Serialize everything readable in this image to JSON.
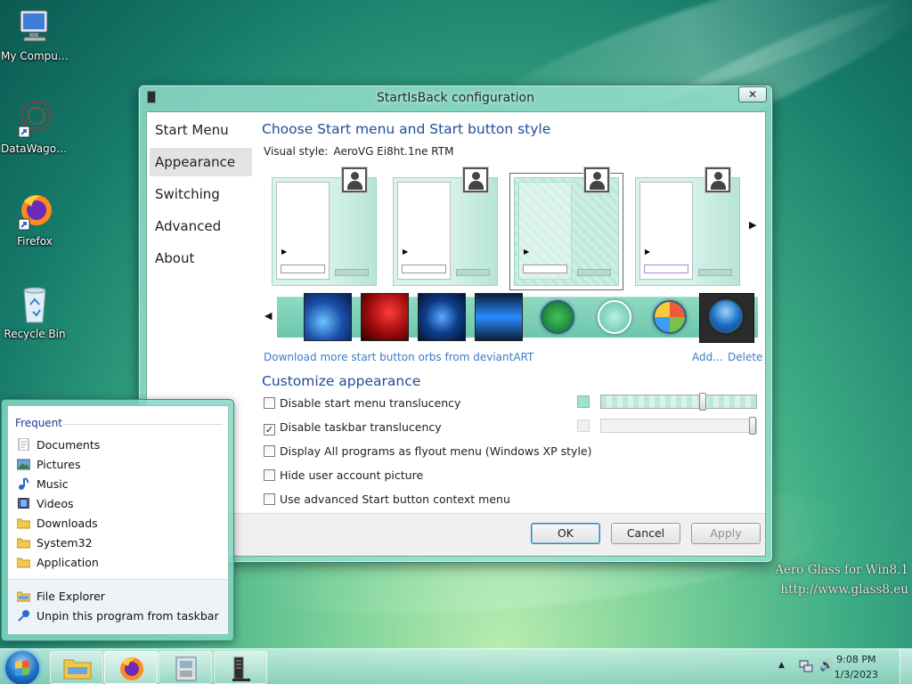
{
  "desktop": {
    "icons": [
      {
        "label": "My Computer",
        "icon": "computer-icon"
      },
      {
        "label": "DataWagon...",
        "icon": "datawagon-icon"
      },
      {
        "label": "Firefox",
        "icon": "firefox-icon"
      },
      {
        "label": "Recycle Bin",
        "icon": "recycle-bin-icon"
      }
    ],
    "watermark": {
      "line1": "Aero Glass for Win8.1",
      "line2": "http://www.glass8.eu"
    }
  },
  "window": {
    "title": "StartIsBack configuration",
    "close_glyph": "✕",
    "nav": [
      "Start Menu",
      "Appearance",
      "Switching",
      "Advanced",
      "About"
    ],
    "active_nav": "Appearance",
    "style_heading": "Choose Start menu and Start button style",
    "visual_style_label": "Visual style:",
    "visual_style_value": "AeroVG Ei8ht.1ne RTM",
    "download_link": "Download more start button orbs from deviantART",
    "add_link": "Add...",
    "delete_link": "Delete",
    "customize_heading": "Customize appearance",
    "options": [
      {
        "label": "Disable start menu translucency",
        "checked": false
      },
      {
        "label": "Disable taskbar translucency",
        "checked": true
      },
      {
        "label": "Display All programs as flyout menu (Windows XP style)",
        "checked": false
      },
      {
        "label": "Hide user account picture",
        "checked": false
      },
      {
        "label": "Use advanced Start button context menu",
        "checked": false
      }
    ],
    "checkmark": "✓",
    "buttons": {
      "ok": "OK",
      "cancel": "Cancel",
      "apply": "Apply"
    },
    "colors": {
      "accent": "#9be3cf",
      "heading": "#1f4d9a",
      "link": "#3b7cc9"
    }
  },
  "jumplist": {
    "heading": "Frequent",
    "items": [
      {
        "label": "Documents",
        "icon": "document-icon"
      },
      {
        "label": "Pictures",
        "icon": "pictures-icon"
      },
      {
        "label": "Music",
        "icon": "music-icon"
      },
      {
        "label": "Videos",
        "icon": "videos-icon"
      },
      {
        "label": "Downloads",
        "icon": "folder-icon"
      },
      {
        "label": "System32",
        "icon": "folder-icon"
      },
      {
        "label": "Application",
        "icon": "folder-icon"
      }
    ],
    "tasks": [
      {
        "label": "File Explorer",
        "icon": "file-explorer-icon"
      },
      {
        "label": "Unpin this program from taskbar",
        "icon": "unpin-icon"
      }
    ]
  },
  "taskbar": {
    "time": "9:08 PM",
    "date": "1/3/2023",
    "tray_arrow": "▲",
    "volume_glyph": "🔊"
  }
}
